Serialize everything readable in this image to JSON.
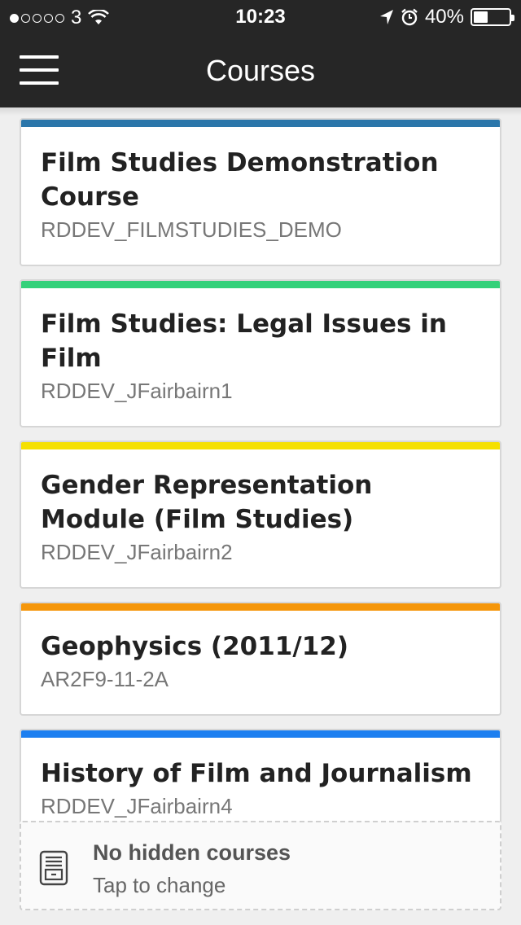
{
  "status_bar": {
    "carrier": "3",
    "time": "10:23",
    "battery": "40%",
    "battery_level": 0.4,
    "signal_bars_filled": 1,
    "signal_bars_total": 5
  },
  "nav": {
    "title": "Courses",
    "menu_icon": "hamburger-menu-icon"
  },
  "courses": [
    {
      "title": "Film Studies Demonstration Course",
      "code": "RDDEV_FILMSTUDIES_DEMO",
      "color": "#2b76aa"
    },
    {
      "title": "Film Studies: Legal Issues in Film",
      "code": "RDDEV_JFairbairn1",
      "color": "#33d17a"
    },
    {
      "title": "Gender Representation Module (Film Studies)",
      "code": "RDDEV_JFairbairn2",
      "color": "#f5e000"
    },
    {
      "title": "Geophysics (2011/12)",
      "code": "AR2F9-11-2A",
      "color": "#f5960a"
    },
    {
      "title": "History of Film and Journalism",
      "code": "RDDEV_JFairbairn4",
      "color": "#1d7ff0"
    }
  ],
  "hidden_courses": {
    "title": "No hidden courses",
    "subtitle": "Tap to change",
    "icon": "archive-icon"
  }
}
